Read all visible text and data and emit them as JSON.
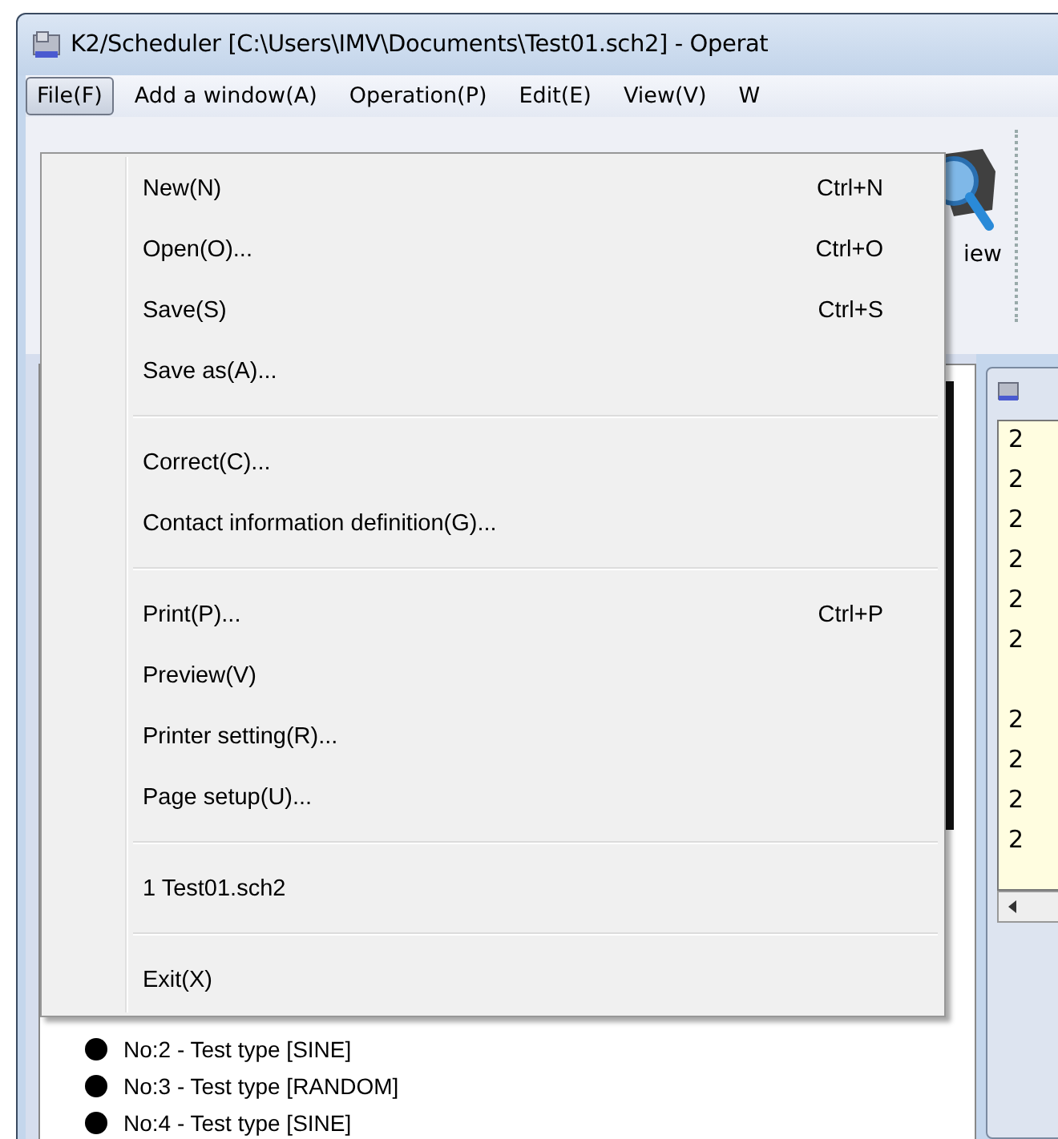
{
  "window": {
    "title": "K2/Scheduler [C:\\Users\\IMV\\Documents\\Test01.sch2] - Operat"
  },
  "menu_bar": [
    {
      "label": "File(F)",
      "selected": true
    },
    {
      "label": "Add a window(A)",
      "selected": false
    },
    {
      "label": "Operation(P)",
      "selected": false
    },
    {
      "label": "Edit(E)",
      "selected": false
    },
    {
      "label": "View(V)",
      "selected": false
    },
    {
      "label": "W",
      "selected": false
    }
  ],
  "toolbar": {
    "button_label": "iew"
  },
  "file_menu": [
    {
      "kind": "item",
      "label": "New(N)",
      "shortcut": "Ctrl+N"
    },
    {
      "kind": "item",
      "label": "Open(O)...",
      "shortcut": "Ctrl+O"
    },
    {
      "kind": "item",
      "label": "Save(S)",
      "shortcut": "Ctrl+S"
    },
    {
      "kind": "item",
      "label": "Save as(A)..."
    },
    {
      "kind": "separator"
    },
    {
      "kind": "item",
      "label": "Correct(C)..."
    },
    {
      "kind": "item",
      "label": "Contact information definition(G)..."
    },
    {
      "kind": "separator"
    },
    {
      "kind": "item",
      "label": "Print(P)...",
      "shortcut": "Ctrl+P"
    },
    {
      "kind": "item",
      "label": "Preview(V)"
    },
    {
      "kind": "item",
      "label": "Printer setting(R)..."
    },
    {
      "kind": "item",
      "label": "Page setup(U)..."
    },
    {
      "kind": "separator"
    },
    {
      "kind": "item",
      "label": "1 Test01.sch2"
    },
    {
      "kind": "separator"
    },
    {
      "kind": "item",
      "label": "Exit(X)"
    }
  ],
  "test_list": [
    {
      "label": "No:2 - Test type [SINE]"
    },
    {
      "label": "No:3 - Test type [RANDOM]"
    },
    {
      "label": "No:4 - Test type [SINE]"
    }
  ],
  "log_rows": [
    "2",
    "2",
    "2",
    "2",
    "2",
    "2",
    "",
    "2",
    "2",
    "2",
    "2"
  ]
}
